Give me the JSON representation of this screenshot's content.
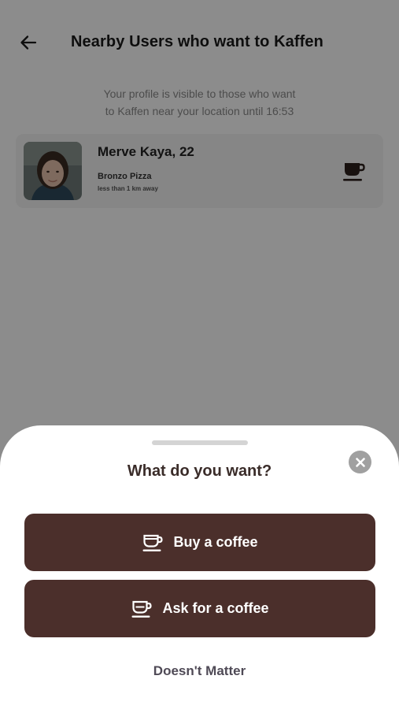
{
  "header": {
    "title": "Nearby Users who want to Kaffen",
    "back_icon": "arrow-left-icon"
  },
  "visibility_note": {
    "line1": "Your profile is visible to those who want",
    "line2": "to Kaffen near your location until 16:53"
  },
  "users": [
    {
      "name_age": "Merve Kaya, 22",
      "place": "Bronzo Pizza",
      "distance": "less than 1 km away",
      "action_icon": "coffee-cup-icon"
    }
  ],
  "sheet": {
    "title": "What do you want?",
    "close_icon": "close-icon",
    "options": [
      {
        "label": "Buy a coffee",
        "icon": "coffee-cup-saucer-icon"
      },
      {
        "label": "Ask for a coffee",
        "icon": "coffee-cup-request-icon"
      }
    ],
    "secondary_option": "Doesn't Matter"
  },
  "colors": {
    "primary_button": "#4b2f2b",
    "title_text": "#3a2c29",
    "overlay": "rgba(0,0,0,0.45)"
  }
}
